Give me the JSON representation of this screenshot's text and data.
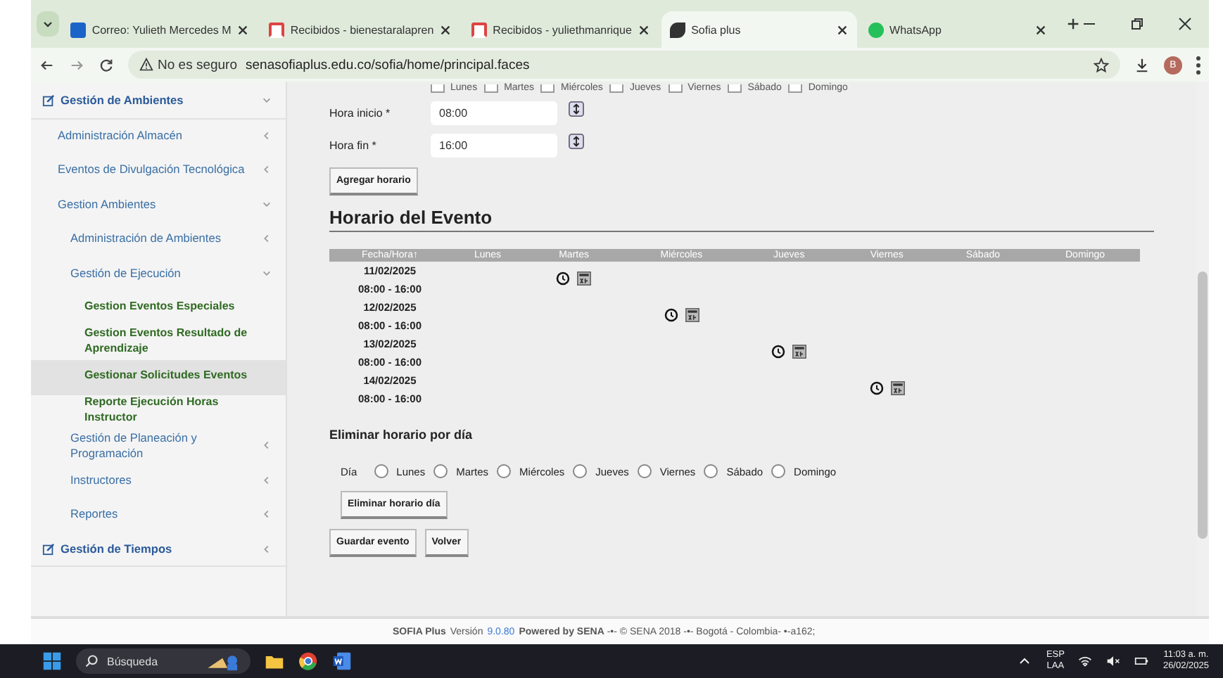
{
  "browser": {
    "tabs": [
      {
        "kind": "mail",
        "title": "Correo: Yulieth Mercedes M",
        "selected": false
      },
      {
        "kind": "gmail",
        "title": "Recibidos - bienestaralapren",
        "selected": false
      },
      {
        "kind": "gmail",
        "title": "Recibidos - yuliethmanrique",
        "selected": false
      },
      {
        "kind": "sofia",
        "title": "Sofia plus",
        "selected": true
      },
      {
        "kind": "chat",
        "title": "WhatsApp",
        "selected": false
      }
    ],
    "security": "No es seguro",
    "url": "senasofiaplus.edu.co/sofia/home/principal.faces",
    "profile": "B"
  },
  "sidebar": {
    "items": [
      {
        "label": "Gestión de Ambientes",
        "expanded": true,
        "children": [
          {
            "label": "Administración Almacén",
            "expanded": false
          },
          {
            "label": "Eventos de Divulgación Tecnológica",
            "expanded": false
          },
          {
            "label": "Gestion Ambientes",
            "expanded": true,
            "children": [
              {
                "label": "Administración de Ambientes",
                "expanded": false
              },
              {
                "label": "Gestión de Ejecución",
                "expanded": true,
                "children": [
                  {
                    "label": "Gestion Eventos Especiales",
                    "selected": false
                  },
                  {
                    "label": "Gestion Eventos Resultado de Aprendizaje",
                    "selected": false
                  },
                  {
                    "label": "Gestionar Solicitudes Eventos",
                    "selected": true
                  },
                  {
                    "label": "Reporte Ejecución Horas Instructor",
                    "selected": false
                  }
                ]
              },
              {
                "label": "Gestión de Planeación y Programación",
                "expanded": false
              },
              {
                "label": "Instructores",
                "expanded": false
              },
              {
                "label": "Reportes",
                "expanded": false
              }
            ]
          }
        ]
      },
      {
        "label": "Gestión de Tiempos",
        "expanded": false
      }
    ]
  },
  "form": {
    "weekdays": [
      {
        "label": "Lunes",
        "checked": false
      },
      {
        "label": "Martes",
        "checked": false
      },
      {
        "label": "Miércoles",
        "checked": false
      },
      {
        "label": "Jueves",
        "checked": false
      },
      {
        "label": "Viernes",
        "checked": false
      },
      {
        "label": "Sábado",
        "checked": false
      },
      {
        "label": "Domingo",
        "checked": false
      }
    ],
    "start_label": "Hora inicio *",
    "start_value": "08:00",
    "end_label": "Hora fin *",
    "end_value": "16:00",
    "add_button": "Agregar horario"
  },
  "schedule": {
    "title": "Horario del Evento",
    "columns": [
      "Fecha/Hora↑",
      "Lunes",
      "Martes",
      "Miércoles",
      "Jueves",
      "Viernes",
      "Sábado",
      "Domingo"
    ],
    "rows": [
      {
        "date": "11/02/2025",
        "time": "08:00 - 16:00",
        "slots": [
          false,
          true,
          false,
          false,
          false,
          false,
          false
        ]
      },
      {
        "date": "12/02/2025",
        "time": "08:00 - 16:00",
        "slots": [
          false,
          false,
          true,
          false,
          false,
          false,
          false
        ]
      },
      {
        "date": "13/02/2025",
        "time": "08:00 - 16:00",
        "slots": [
          false,
          false,
          false,
          true,
          false,
          false,
          false
        ]
      },
      {
        "date": "14/02/2025",
        "time": "08:00 - 16:00",
        "slots": [
          false,
          false,
          false,
          false,
          true,
          false,
          false
        ]
      }
    ]
  },
  "delete_by_day": {
    "title": "Eliminar horario por día",
    "day_label": "Día",
    "days": [
      {
        "label": "Lunes",
        "selected": false
      },
      {
        "label": "Martes",
        "selected": false
      },
      {
        "label": "Miércoles",
        "selected": false
      },
      {
        "label": "Jueves",
        "selected": false
      },
      {
        "label": "Viernes",
        "selected": false
      },
      {
        "label": "Sábado",
        "selected": false
      },
      {
        "label": "Domingo",
        "selected": false
      }
    ],
    "button": "Eliminar horario día"
  },
  "actions": [
    "Guardar evento",
    "Volver"
  ],
  "footer": {
    "brand": "SOFIA Plus",
    "version_label": "Versión",
    "version": "9.0.80",
    "text": "**Powered by SENA** -•- © SENA 2018 -•- Bogotá - Colombia- •-a162;"
  },
  "taskbar": {
    "search_placeholder": "Búsqueda",
    "language": "ESP",
    "layout": "LAA",
    "time": "11:03 a. m.",
    "date": "26/02/2025"
  }
}
